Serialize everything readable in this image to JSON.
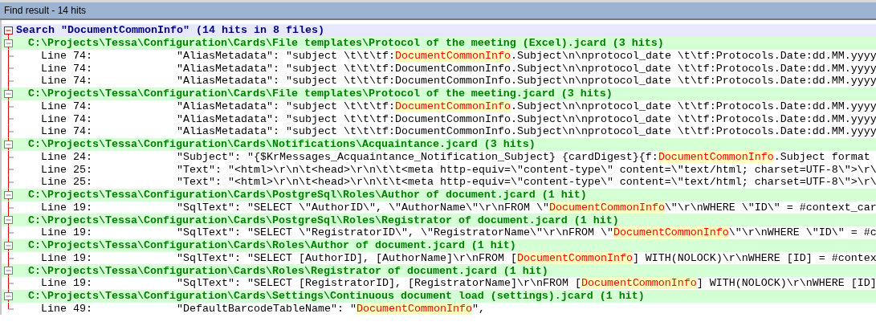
{
  "panel": {
    "title": "Find result - 14 hits"
  },
  "search": {
    "label": "Search \"DocumentCommonInfo\" (14 hits in 8 files)",
    "expanded": true,
    "files": [
      {
        "path": "C:\\Projects\\Tessa\\Configuration\\Cards\\File templates\\Protocol of the meeting (Excel).jcard (3 hits)",
        "expanded": true,
        "hits": [
          {
            "line": "Line 74:",
            "segments": [
              {
                "text": "\"AliasMetadata\": \"subject \\t\\t\\tf:",
                "match": false
              },
              {
                "text": "DocumentCommonInfo",
                "match": true
              },
              {
                "text": ".Subject\\n\\nprotocol_date \\t\\tf:Protocols.Date:dd.MM.yyyy",
                "match": false
              }
            ]
          },
          {
            "line": "Line 74:",
            "segments": [
              {
                "text": "\"AliasMetadata\": \"subject \\t\\t\\tf:DocumentCommonInfo.Subject\\n\\nprotocol_date \\t\\tf:Protocols.Date:dd.MM.yyyy",
                "match": false
              }
            ]
          },
          {
            "line": "Line 74:",
            "segments": [
              {
                "text": "\"AliasMetadata\": \"subject \\t\\t\\tf:DocumentCommonInfo.Subject\\n\\nprotocol_date \\t\\tf:Protocols.Date:dd.MM.yyyy",
                "match": false
              }
            ]
          }
        ]
      },
      {
        "path": "C:\\Projects\\Tessa\\Configuration\\Cards\\File templates\\Protocol of the meeting.jcard (3 hits)",
        "expanded": true,
        "hits": [
          {
            "line": "Line 74:",
            "segments": [
              {
                "text": "\"AliasMetadata\": \"subject \\t\\t\\tf:",
                "match": false
              },
              {
                "text": "DocumentCommonInfo",
                "match": true
              },
              {
                "text": ".Subject\\n\\nprotocol_date \\t\\tf:Protocols.Date:dd.MM.yyyy",
                "match": false
              }
            ]
          },
          {
            "line": "Line 74:",
            "segments": [
              {
                "text": "\"AliasMetadata\": \"subject \\t\\t\\tf:DocumentCommonInfo.Subject\\n\\nprotocol_date \\t\\tf:Protocols.Date:dd.MM.yyyy",
                "match": false
              }
            ]
          },
          {
            "line": "Line 74:",
            "segments": [
              {
                "text": "\"AliasMetadata\": \"subject \\t\\t\\tf:DocumentCommonInfo.Subject\\n\\nprotocol_date \\t\\tf:Protocols.Date:dd.MM.yyyy",
                "match": false
              }
            ]
          }
        ]
      },
      {
        "path": "C:\\Projects\\Tessa\\Configuration\\Cards\\Notifications\\Acquaintance.jcard (3 hits)",
        "expanded": true,
        "hits": [
          {
            "line": "Line 24:",
            "segments": [
              {
                "text": "\"Subject\": \"{$KrMessages_Acquaintance_Notification_Subject} {cardDigest}{f:",
                "match": false
              },
              {
                "text": "DocumentCommonInfo",
                "match": true
              },
              {
                "text": ".Subject format",
                "match": false
              }
            ]
          },
          {
            "line": "Line 25:",
            "segments": [
              {
                "text": "\"Text\": \"<html>\\r\\n\\t<head>\\r\\n\\t\\t<meta http-equiv=\\\"content-type\\\" content=\\\"text/html; charset=UTF-8\\\">\\r\\",
                "match": false
              }
            ]
          },
          {
            "line": "Line 25:",
            "segments": [
              {
                "text": "\"Text\": \"<html>\\r\\n\\t<head>\\r\\n\\t\\t<meta http-equiv=\\\"content-type\\\" content=\\\"text/html; charset=UTF-8\\\">\\r\\",
                "match": false
              }
            ]
          }
        ]
      },
      {
        "path": "C:\\Projects\\Tessa\\Configuration\\Cards\\PostgreSql\\Roles\\Author of document.jcard (1 hit)",
        "expanded": true,
        "hits": [
          {
            "line": "Line 19:",
            "segments": [
              {
                "text": "\"SqlText\": \"SELECT \\\"AuthorID\\\", \\\"AuthorName\\\"\\r\\nFROM \\\"",
                "match": false
              },
              {
                "text": "DocumentCommonInfo",
                "match": true
              },
              {
                "text": "\\\"\\r\\nWHERE \\\"ID\\\" = #context_car",
                "match": false
              }
            ]
          }
        ]
      },
      {
        "path": "C:\\Projects\\Tessa\\Configuration\\Cards\\PostgreSql\\Roles\\Registrator of document.jcard (1 hit)",
        "expanded": true,
        "hits": [
          {
            "line": "Line 19:",
            "segments": [
              {
                "text": "\"SqlText\": \"SELECT \\\"RegistratorID\\\", \\\"RegistratorName\\\"\\r\\nFROM \\\"",
                "match": false
              },
              {
                "text": "DocumentCommonInfo",
                "match": true
              },
              {
                "text": "\\\"\\r\\nWHERE \\\"ID\\\" = #c",
                "match": false
              }
            ]
          }
        ]
      },
      {
        "path": "C:\\Projects\\Tessa\\Configuration\\Cards\\Roles\\Author of document.jcard (1 hit)",
        "expanded": true,
        "hits": [
          {
            "line": "Line 19:",
            "segments": [
              {
                "text": "\"SqlText\": \"SELECT [AuthorID], [AuthorName]\\r\\nFROM [",
                "match": false
              },
              {
                "text": "DocumentCommonInfo",
                "match": true
              },
              {
                "text": "] WITH(NOLOCK)\\r\\nWHERE [ID] = #contex",
                "match": false
              }
            ]
          }
        ]
      },
      {
        "path": "C:\\Projects\\Tessa\\Configuration\\Cards\\Roles\\Registrator of document.jcard (1 hit)",
        "expanded": true,
        "hits": [
          {
            "line": "Line 19:",
            "segments": [
              {
                "text": "\"SqlText\": \"SELECT [RegistratorID], [RegistratorName]\\r\\nFROM [",
                "match": false
              },
              {
                "text": "DocumentCommonInfo",
                "match": true
              },
              {
                "text": "] WITH(NOLOCK)\\r\\nWHERE [ID]",
                "match": false
              }
            ]
          }
        ]
      },
      {
        "path": "C:\\Projects\\Tessa\\Configuration\\Cards\\Settings\\Continuous document load (settings).jcard (1 hit)",
        "expanded": true,
        "hits": [
          {
            "line": "Line 49:",
            "segments": [
              {
                "text": "\"DefaultBarcodeTableName\": \"",
                "match": false
              },
              {
                "text": "DocumentCommonInfo",
                "match": true
              },
              {
                "text": "\",",
                "match": false
              }
            ]
          }
        ]
      }
    ]
  }
}
